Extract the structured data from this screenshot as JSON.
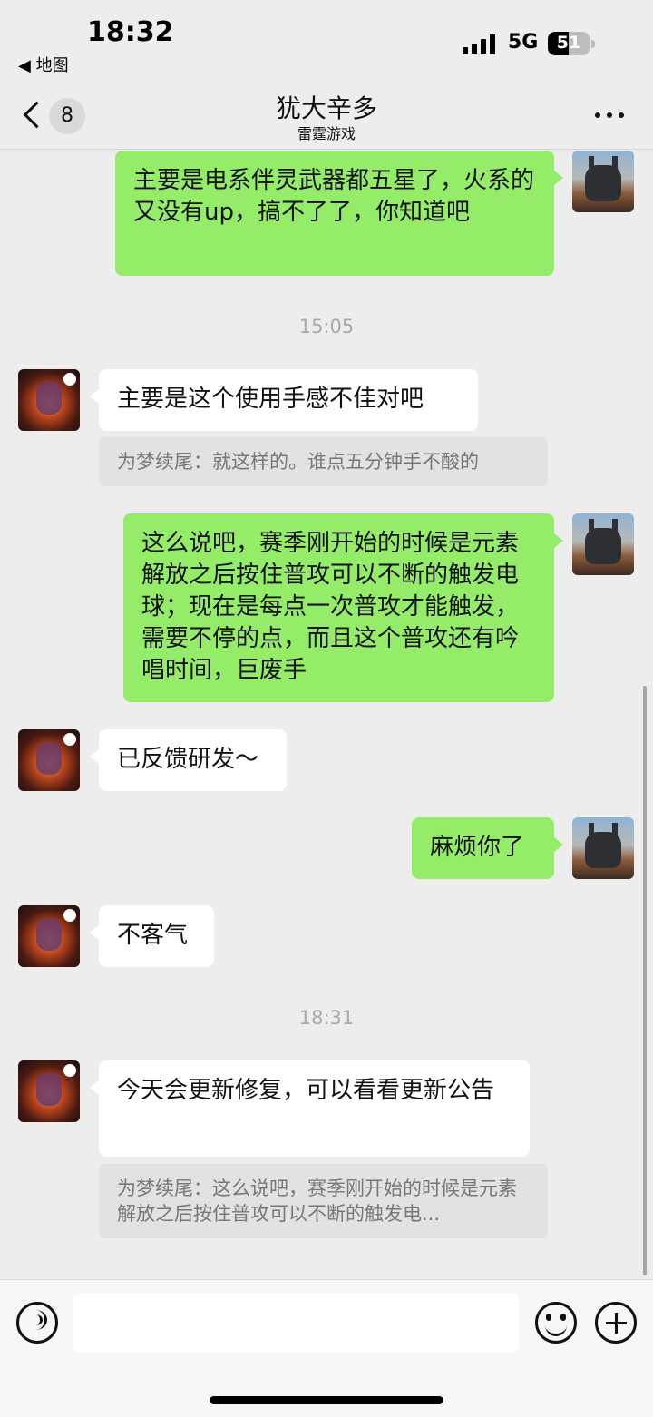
{
  "status_bar": {
    "time": "18:32",
    "back_app": "◀ 地图",
    "network": "5G",
    "battery": "51",
    "battery_level": 0.51
  },
  "nav": {
    "unread_count": "8",
    "title": "犹大辛多",
    "subtitle": "雷霆游戏"
  },
  "messages": {
    "m1": "主要是电系伴灵武器都五星了，火系的又没有up，搞不了了，你知道吧",
    "ts1": "15:05",
    "m2": "主要是这个使用手感不佳对吧",
    "q2": "为梦续尾：就这样的。谁点五分钟手不酸的",
    "m3": "这么说吧，赛季刚开始的时候是元素解放之后按住普攻可以不断的触发电球；现在是每点一次普攻才能触发，需要不停的点，而且这个普攻还有吟唱时间，巨废手",
    "m4": "已反馈研发～",
    "m5": "麻烦你了",
    "m6": "不客气",
    "ts2": "18:31",
    "m7": "今天会更新修复，可以看看更新公告",
    "q7": "为梦续尾：这么说吧，赛季刚开始的时候是元素解放之后按住普攻可以不断的触发电..."
  },
  "input": {
    "placeholder": ""
  },
  "colors": {
    "background": "#ededed",
    "my_bubble": "#95ec69",
    "their_bubble": "#ffffff",
    "quote_bg": "#e2e2e2"
  }
}
